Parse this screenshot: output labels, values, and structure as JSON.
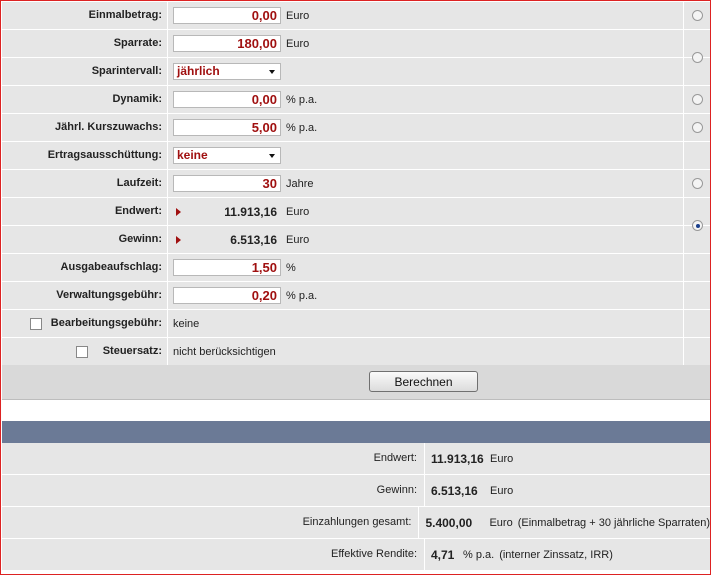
{
  "form": {
    "einmalbetrag": {
      "label": "Einmalbetrag:",
      "value": "0,00",
      "unit": "Euro"
    },
    "sparrate": {
      "label": "Sparrate:",
      "value": "180,00",
      "unit": "Euro"
    },
    "sparintervall": {
      "label": "Sparintervall:",
      "value": "jährlich"
    },
    "dynamik": {
      "label": "Dynamik:",
      "value": "0,00",
      "unit": "% p.a."
    },
    "kurszuwachs": {
      "label": "Jährl. Kurszuwachs:",
      "value": "5,00",
      "unit": "% p.a."
    },
    "ertrag": {
      "label": "Ertragsausschüttung:",
      "value": "keine"
    },
    "laufzeit": {
      "label": "Laufzeit:",
      "value": "30",
      "unit": "Jahre"
    },
    "endwert": {
      "label": "Endwert:",
      "value": "11.913,16",
      "unit": "Euro"
    },
    "gewinn": {
      "label": "Gewinn:",
      "value": "6.513,16",
      "unit": "Euro"
    },
    "ausgabeaufschlag": {
      "label": "Ausgabeaufschlag:",
      "value": "1,50",
      "unit": "%"
    },
    "verwaltung": {
      "label": "Verwaltungsgebühr:",
      "value": "0,20",
      "unit": "% p.a."
    },
    "bearbeitung": {
      "label": "Bearbeitungsgebühr:",
      "value": "keine"
    },
    "steuersatz": {
      "label": "Steuersatz:",
      "value": "nicht berücksichtigen"
    },
    "calc_button": "Berechnen",
    "selected_radio": "endwert"
  },
  "results": {
    "endwert": {
      "label": "Endwert:",
      "value": "11.913,16",
      "unit": "Euro"
    },
    "gewinn": {
      "label": "Gewinn:",
      "value": "6.513,16",
      "unit": "Euro"
    },
    "einzahlungen": {
      "label": "Einzahlungen gesamt:",
      "value": "5.400,00",
      "unit": "Euro",
      "note": "(Einmalbetrag + 30 jährliche Sparraten)"
    },
    "rendite": {
      "label": "Effektive Rendite:",
      "value": "4,71",
      "unit": "% p.a.",
      "note": "(interner Zinssatz, IRR)"
    }
  },
  "colors": {
    "accent": "#a01010",
    "header_bar": "#6b7a96",
    "border": "#dd2222"
  }
}
